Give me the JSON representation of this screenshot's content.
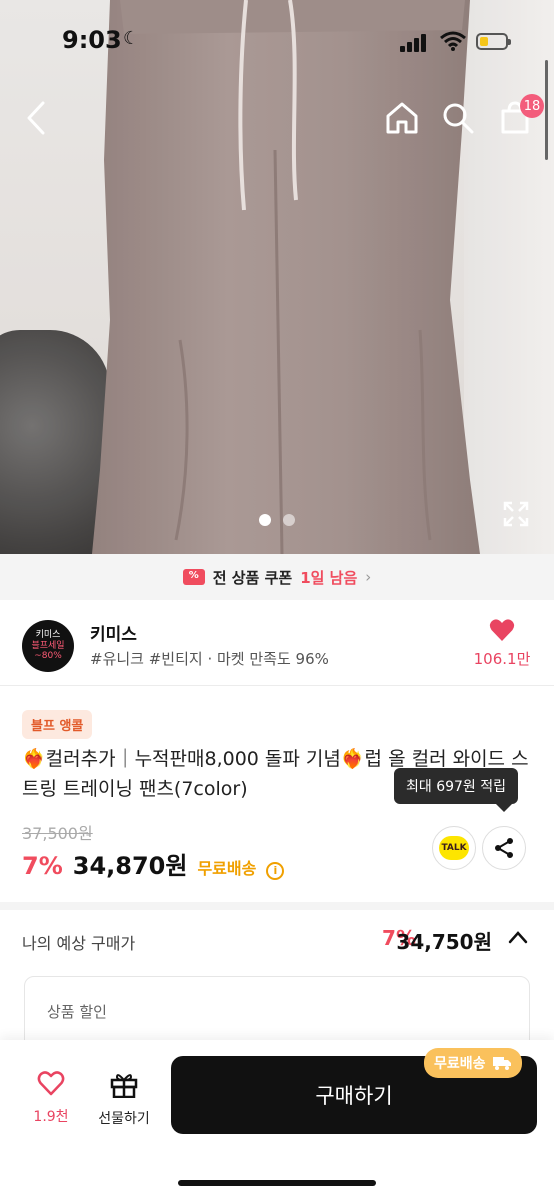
{
  "status": {
    "time": "9:03",
    "battery_color": "#f5c518"
  },
  "nav": {
    "cart_count": "18"
  },
  "gallery": {
    "page_count": 2,
    "active_index": 0
  },
  "coupon": {
    "text": "전 상품 쿠폰",
    "highlight": "1일 남음"
  },
  "shop": {
    "logo_line1": "키미스",
    "logo_line2": "블프세일",
    "logo_line3": "~80%",
    "name": "키미스",
    "tags": "#유니크 #빈티지 · 마켓 만족도 96%",
    "likes": "106.1만"
  },
  "product": {
    "badge": "블프 앵콜",
    "title": "❤️‍🔥컬러추가｜누적판매8,000 돌파 기념❤️‍🔥럽 올 컬러 와이드 스트링 트레이닝 팬츠(7color)",
    "tooltip": "최대 697원 적립",
    "original_price": "37,500원",
    "discount": "7%",
    "price": "34,870원",
    "free_shipping": "무료배송",
    "talk_label": "TALK"
  },
  "expected": {
    "label": "나의 예상 구매가",
    "discount": "7%",
    "price": "34,750원"
  },
  "discount_box": {
    "label": "상품 할인"
  },
  "bottom": {
    "wish_count": "1.9천",
    "gift_label": "선물하기",
    "buy_label": "구매하기",
    "ship_badge": "무료배송"
  },
  "colors": {
    "accent": "#f04c5e",
    "shipping": "#f0a000"
  }
}
